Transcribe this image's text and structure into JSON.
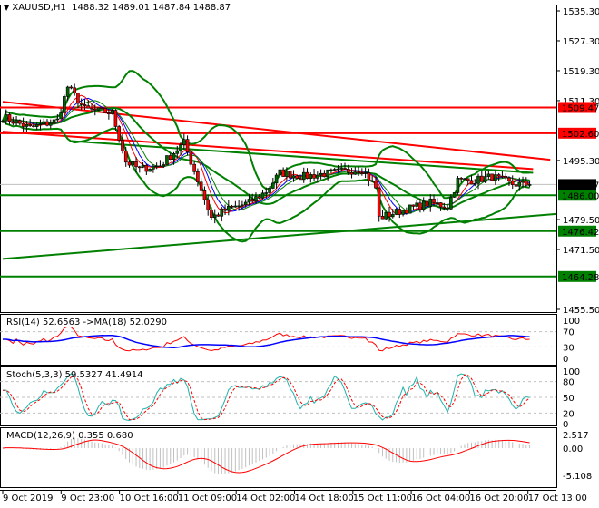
{
  "header": {
    "symbol": "XAUUSD,H1",
    "open": "1488.32",
    "high": "1489.01",
    "low": "1487.84",
    "close": "1488.87"
  },
  "price_axis": [
    "1535.30",
    "1527.30",
    "1519.30",
    "1511.30",
    "1495.30",
    "1479.50",
    "1471.50",
    "1455.50"
  ],
  "price_tags": [
    {
      "value": "1509.47",
      "color": "#ff0000"
    },
    {
      "value": "1502.60",
      "color": "#ff0000"
    },
    {
      "value": "1488.87",
      "color": "#000000"
    },
    {
      "value": "1486.00",
      "color": "#008000"
    },
    {
      "value": "1476.42",
      "color": "#008000"
    },
    {
      "value": "1464.28",
      "color": "#008000"
    }
  ],
  "rsi": {
    "label": "RSI(14) 52.6563  ->MA(18) 52.0290",
    "levels": [
      "100",
      "70",
      "30",
      "0"
    ]
  },
  "stoch": {
    "label": "Stoch(5,3,3) 59.5327 41.4914",
    "levels": [
      "100",
      "80",
      "50",
      "20",
      "0"
    ]
  },
  "macd": {
    "label": "MACD(12,26,9) 0.355 0.680",
    "levels": [
      "2.517",
      "0.00",
      "-5.108"
    ]
  },
  "time_axis": [
    "9 Oct 2019",
    "9 Oct 23:00",
    "10 Oct 16:00",
    "11 Oct 09:00",
    "14 Oct 02:00",
    "14 Oct 18:00",
    "15 Oct 11:00",
    "16 Oct 04:00",
    "16 Oct 20:00",
    "17 Oct 13:00"
  ],
  "chart_data": {
    "type": "candlestick",
    "symbol": "XAUUSD",
    "timeframe": "H1",
    "ylim": [
      1455.5,
      1535.3
    ],
    "bars": 155,
    "close_path": [
      [
        0,
        1507
      ],
      [
        8,
        1504
      ],
      [
        16,
        1506
      ],
      [
        19,
        1515
      ],
      [
        24,
        1509
      ],
      [
        32,
        1508
      ],
      [
        36,
        1495
      ],
      [
        40,
        1493
      ],
      [
        46,
        1494
      ],
      [
        53,
        1500
      ],
      [
        57,
        1490
      ],
      [
        61,
        1480
      ],
      [
        65,
        1482
      ],
      [
        72,
        1484
      ],
      [
        77,
        1487
      ],
      [
        81,
        1492
      ],
      [
        88,
        1491
      ],
      [
        96,
        1492
      ],
      [
        105,
        1493
      ],
      [
        109,
        1488
      ],
      [
        110,
        1480
      ],
      [
        117,
        1482
      ],
      [
        125,
        1484
      ],
      [
        130,
        1483
      ],
      [
        133,
        1490
      ],
      [
        138,
        1490
      ],
      [
        143,
        1491
      ],
      [
        149,
        1489
      ],
      [
        154,
        1488.87
      ]
    ],
    "horizontal_levels": [
      {
        "price": 1509.47,
        "color": "red"
      },
      {
        "price": 1502.6,
        "color": "red"
      },
      {
        "price": 1486.0,
        "color": "green"
      },
      {
        "price": 1476.42,
        "color": "green"
      },
      {
        "price": 1464.28,
        "color": "green"
      }
    ],
    "trendlines": [
      {
        "color": "red",
        "from": [
          0,
          1511
        ],
        "to": [
          160,
          1495.5
        ]
      },
      {
        "color": "red",
        "from": [
          0,
          1503
        ],
        "to": [
          155,
          1493
        ]
      },
      {
        "color": "green",
        "from": [
          0,
          1469
        ],
        "to": [
          162,
          1481
        ]
      },
      {
        "color": "green",
        "from": [
          20,
          1500.5
        ],
        "to": [
          155,
          1492
        ]
      }
    ]
  }
}
